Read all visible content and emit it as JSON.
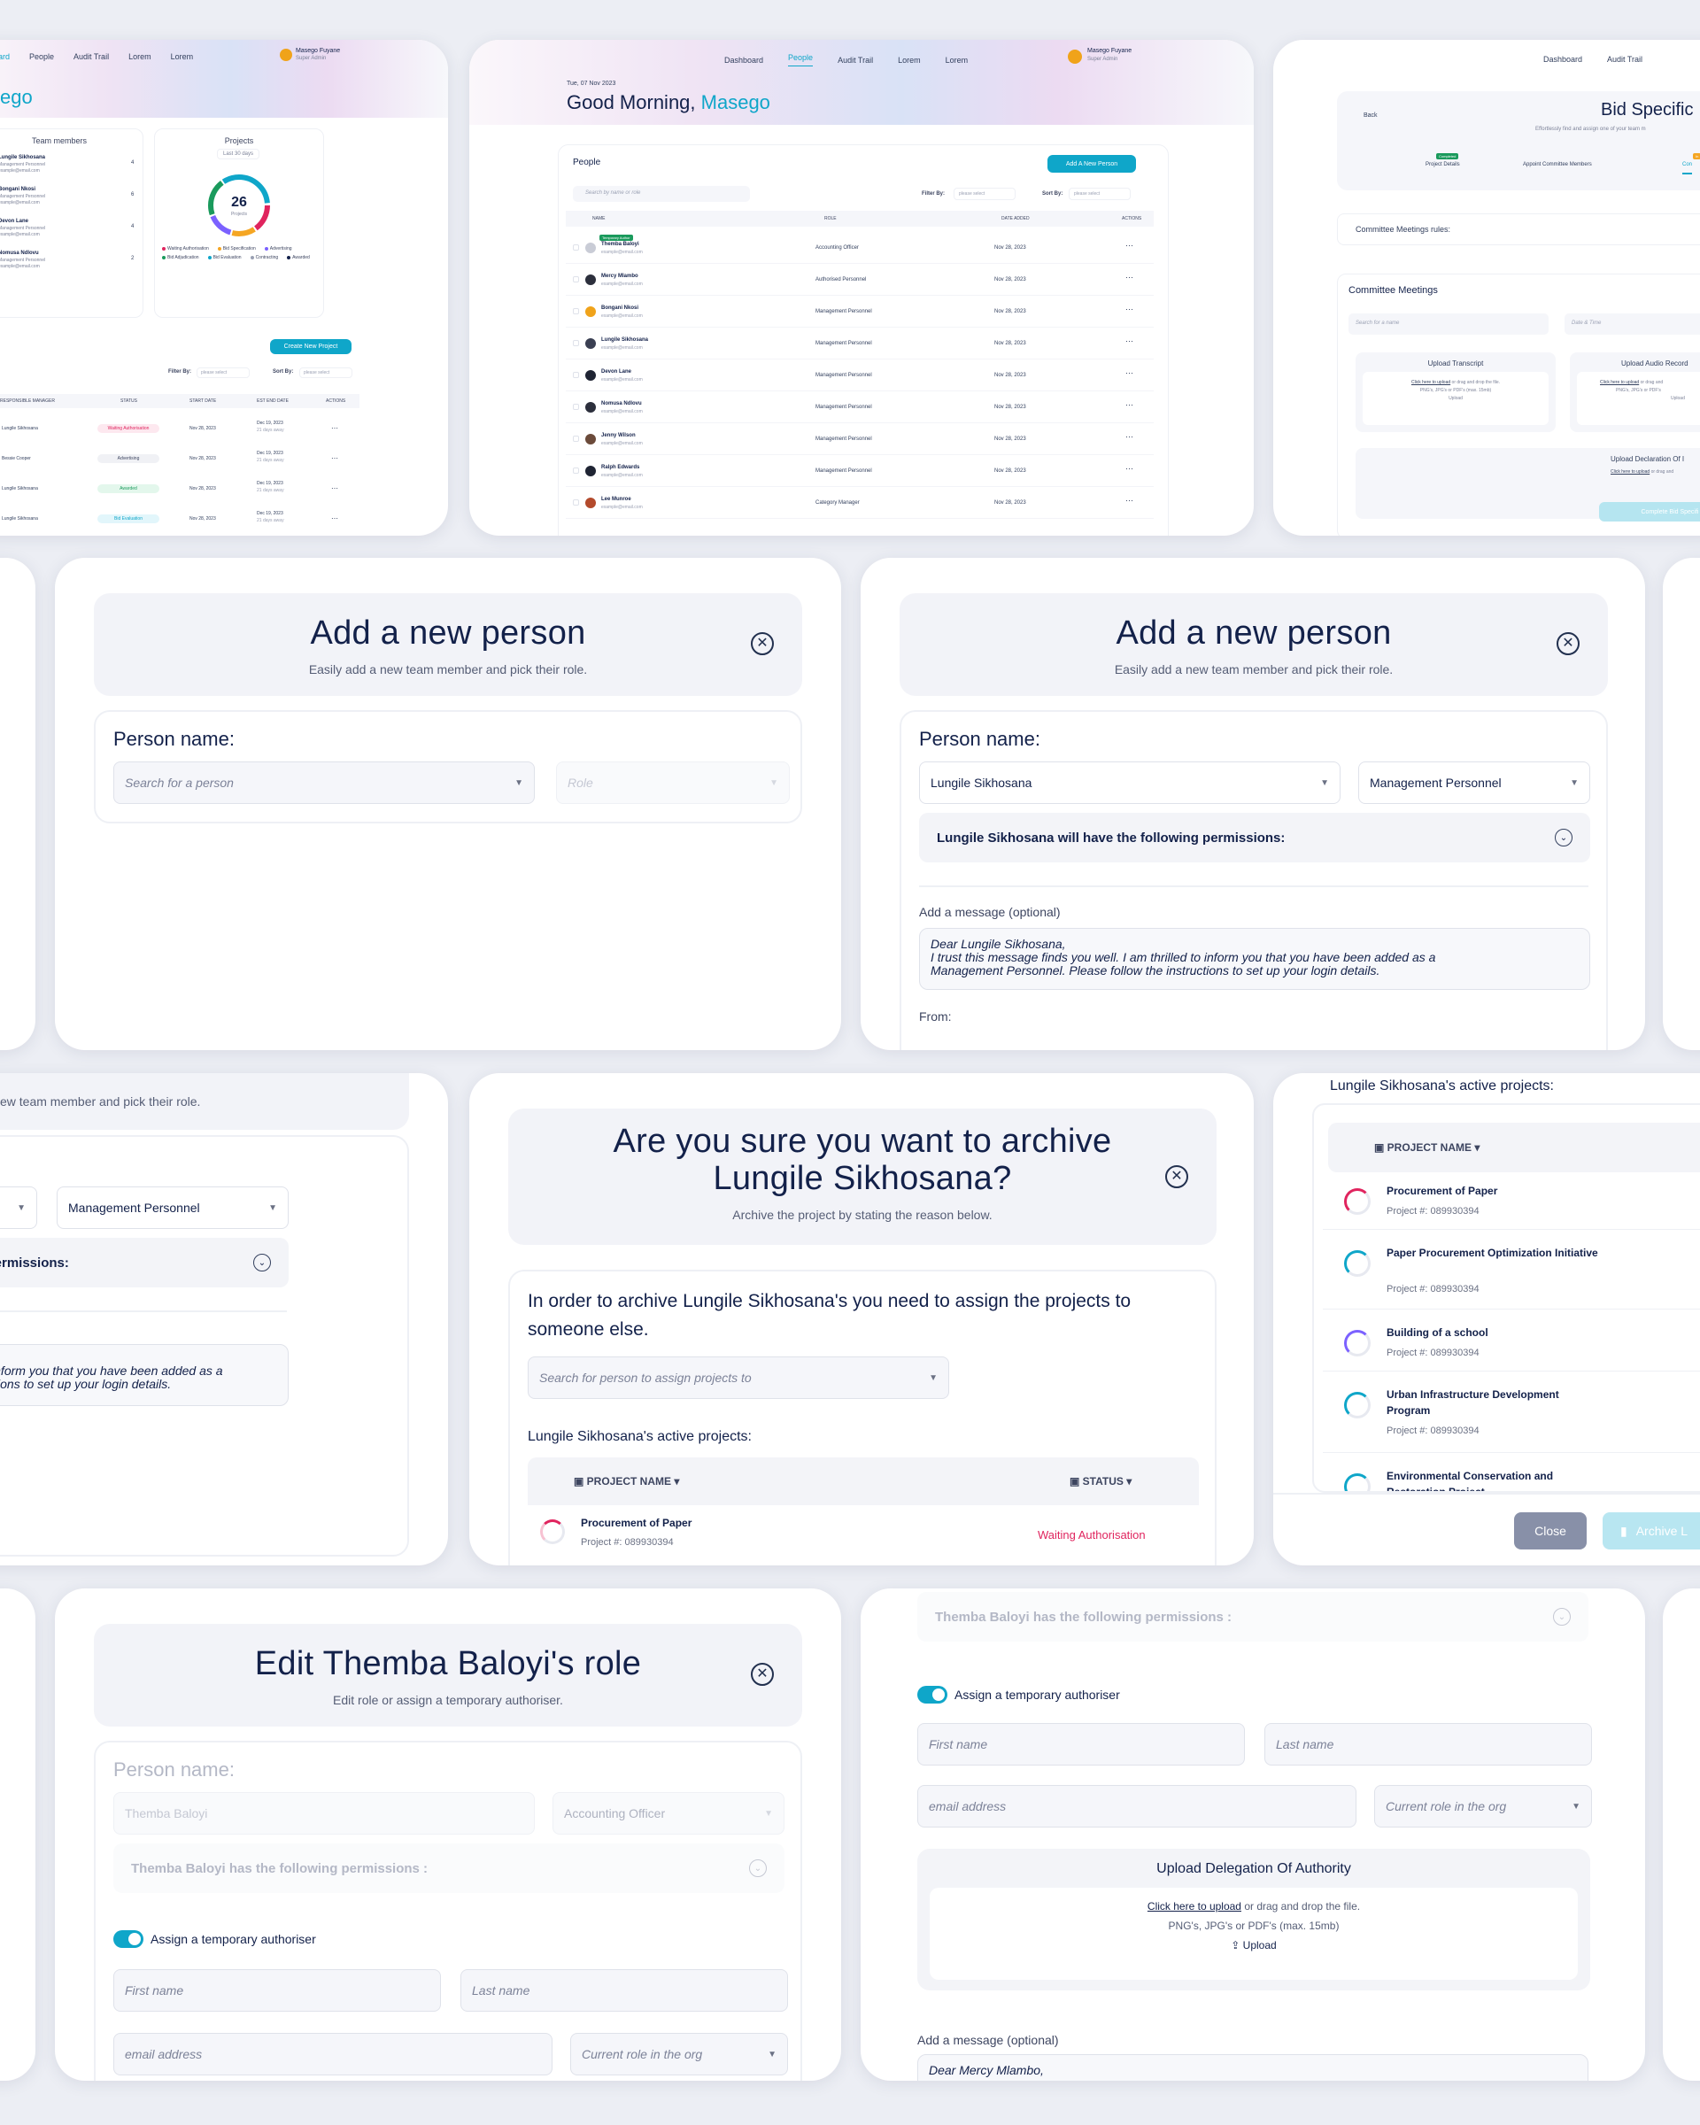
{
  "people_screen": {
    "date": "Tue, 07 Nov 2023",
    "greeting": "Good Morning, ",
    "greeting_name": "Masego",
    "nav": [
      "Dashboard",
      "People",
      "Audit Trail",
      "Lorem",
      "Lorem"
    ],
    "user_name": "Masego Fuyane",
    "user_role": "Super Admin",
    "section_title": "People",
    "add_button": "Add A New Person",
    "search_placeholder": "Search by name or role",
    "filter_label": "Filter By:",
    "sort_label": "Sort By:",
    "select_placeholder": "please select",
    "columns": [
      "NAME",
      "ROLE",
      "DATE ADDED",
      "ACTIONS"
    ],
    "rows": [
      {
        "name": "Themba Baloyi",
        "email": "example@email.com",
        "role": "Accounting Officer",
        "date": "Nov 28, 2023",
        "badge": "Temporary Author"
      },
      {
        "name": "Mercy Mlambo",
        "email": "example@email.com",
        "role": "Authorised Personnel",
        "date": "Nov 28, 2023"
      },
      {
        "name": "Bongani Nkosi",
        "email": "example@email.com",
        "role": "Management Personnel",
        "date": "Nov 28, 2023"
      },
      {
        "name": "Lungile Sikhosana",
        "email": "example@email.com",
        "role": "Management Personnel",
        "date": "Nov 28, 2023"
      },
      {
        "name": "Devon Lane",
        "email": "example@email.com",
        "role": "Management Personnel",
        "date": "Nov 28, 2023"
      },
      {
        "name": "Nomusa Ndlovu",
        "email": "example@email.com",
        "role": "Management Personnel",
        "date": "Nov 28, 2023"
      },
      {
        "name": "Jenny Wilson",
        "email": "example@email.com",
        "role": "Management Personnel",
        "date": "Nov 28, 2023"
      },
      {
        "name": "Ralph Edwards",
        "email": "example@email.com",
        "role": "Management Personnel",
        "date": "Nov 28, 2023"
      },
      {
        "name": "Lee Munroe",
        "email": "example@email.com",
        "role": "Category Manager",
        "date": "Nov 28, 2023"
      }
    ]
  },
  "dashboard_screen": {
    "nav": [
      "People",
      "Audit Trail",
      "Lorem",
      "Lorem"
    ],
    "nav_first": "ard",
    "user_name": "Masego Fuyane",
    "user_role": "Super Admin",
    "greeting_fragment": "ego",
    "team_title": "Team members",
    "team": [
      {
        "name": "Lungile Sikhosana",
        "role": "Management Personnel",
        "email": "example@email.com",
        "count": "4"
      },
      {
        "name": "Bongani Nkosi",
        "role": "Management Personnel",
        "email": "example@email.com",
        "count": "6"
      },
      {
        "name": "Devon Lane",
        "role": "Management Personnel",
        "email": "example@email.com",
        "count": "4"
      },
      {
        "name": "Nomusa Ndlovu",
        "role": "Management Personnel",
        "email": "example@email.com",
        "count": "2"
      }
    ],
    "projects_title": "Projects",
    "projects_range": "Last 30 days",
    "projects_total": "26",
    "projects_total_label": "Projects",
    "legend": [
      "Waiting Authorisation",
      "Bid Specification",
      "Advertising",
      "Bid Adjudication",
      "Bid Evaluation",
      "Contracting",
      "Awarded"
    ],
    "create_button": "Create New Project",
    "filter_label": "Filter By:",
    "sort_label": "Sort By:",
    "select_placeholder": "please select",
    "columns": [
      "RESPONSIBLE MANAGER",
      "STATUS",
      "START DATE",
      "EST END DATE",
      "ACTIONS"
    ],
    "rows": [
      {
        "manager": "Lungile Sikhosana",
        "status": "Waiting Authorisation",
        "start": "Nov 28, 2023",
        "end": "Dec 19, 2023",
        "left": "21 days away",
        "color": "#e0245e",
        "bg": "#fde8ef"
      },
      {
        "manager": "Bessie Cooper",
        "status": "Advertising",
        "start": "Nov 28, 2023",
        "end": "Dec 19, 2023",
        "left": "21 days away",
        "color": "#3d4560",
        "bg": "#f0f1f5"
      },
      {
        "manager": "Lungile Sikhosana",
        "status": "Awarded",
        "start": "Nov 28, 2023",
        "end": "Dec 19, 2023",
        "left": "21 days away",
        "color": "#1a9a5c",
        "bg": "#e3f7ec"
      },
      {
        "manager": "Lungile Sikhosana",
        "status": "Bid Evaluation",
        "start": "Nov 28, 2023",
        "end": "Dec 19, 2023",
        "left": "21 days away",
        "color": "#0fa6c9",
        "bg": "#e2f6fb"
      }
    ]
  },
  "bid_screen": {
    "nav": [
      "Dashboard",
      "Audit Trail"
    ],
    "back": "Back",
    "title": "Bid Specific",
    "subtitle": "Effortlessly find and assign one of your team m",
    "steps": [
      {
        "badge": "Completed",
        "label": "Project Details"
      },
      {
        "label": "Appoint Committee Members"
      },
      {
        "badge": "In",
        "label": "Con"
      }
    ],
    "rules_label": "Committee Meetings rules:",
    "meetings_title": "Committee Meetings",
    "search_placeholder": "Search for a name",
    "date_placeholder": "Date & Time",
    "upload_transcript": "Upload Transcript",
    "upload_audio": "Upload Audio Record",
    "upload_declaration": "Upload Declaration Of I",
    "upload_link": "Click here to upload",
    "upload_rest": "or drag and drop the file.",
    "upload_rest_short": "or drag and",
    "upload_types": "PNG's, JPG's or PDF's (max. 15mb)",
    "upload_types_short": "PNG's, JPG's or PDF's",
    "upload_btn": "Upload",
    "complete_btn": "Complete Bid Specifi"
  },
  "add_person_empty": {
    "title": "Add a new person",
    "subtitle": "Easily add a new team member and pick their role.",
    "person_label": "Person name:",
    "search_placeholder": "Search for a person",
    "role_placeholder": "Role"
  },
  "add_person_filled": {
    "title": "Add a new person",
    "subtitle": "Easily add a new team member and pick their role.",
    "person_label": "Person name:",
    "person_value": "Lungile Sikhosana",
    "role_value": "Management Personnel",
    "permissions": "Lungile Sikhosana will have the following permissions:",
    "message_label": "Add a message (optional)",
    "message_line1": "Dear Lungile Sikhosana,",
    "message_line2": "I trust this message finds you well. I am thrilled to inform you that you have been added as a",
    "message_line3": "Management Personnel. Please follow the instructions to set up your login details.",
    "from_label": "From:"
  },
  "add_person_partial": {
    "subtitle": "ew team member and pick their role.",
    "role_value": "Management Personnel",
    "permissions": "ng permissions:",
    "message_line1": "ed to inform you that you have been added as a",
    "message_line2": "nstructions to set up your login details."
  },
  "archive_modal": {
    "title_line1": "Are you sure you want to archive",
    "title_line2": "Lungile Sikhosana?",
    "subtitle": "Archive the project by stating the reason below.",
    "instruction": "In order to archive Lungile Sikhosana's you need to assign the projects to someone else.",
    "search_placeholder": "Search for person to assign projects to",
    "active_projects_label": "Lungile Sikhosana's active projects:",
    "col_project": "PROJECT NAME",
    "col_status": "STATUS",
    "project_name": "Procurement of Paper",
    "project_number": "Project #: 089930394",
    "project_status": "Waiting Authorisation"
  },
  "active_projects": {
    "label": "Lungile Sikhosana's active projects:",
    "col_project": "PROJECT NAME",
    "projects": [
      {
        "name": "Procurement of Paper",
        "number": "Project #: 089930394"
      },
      {
        "name": "Paper Procurement Optimization Initiative",
        "number": "Project #: 089930394"
      },
      {
        "name": "Building of a school",
        "number": "Project #: 089930394"
      },
      {
        "name": "Urban Infrastructure Development Program",
        "number": "Project #: 089930394"
      },
      {
        "name": "Environmental Conservation and Restoration Project",
        "number": ""
      }
    ],
    "close_btn": "Close",
    "archive_btn": "Archive L"
  },
  "edit_role": {
    "title": "Edit Themba Baloyi's role",
    "subtitle": "Edit role or assign a temporary authoriser.",
    "person_label": "Person name:",
    "person_value": "Themba Baloyi",
    "role_value": "Accounting Officer",
    "permissions": "Themba Baloyi has the following permissions :",
    "toggle_label": "Assign a temporary authoriser",
    "first_name": "First name",
    "last_name": "Last name",
    "email": "email address",
    "current_role": "Current role in the org"
  },
  "temp_authoriser": {
    "permissions": "Themba Baloyi has the following permissions :",
    "toggle_label": "Assign a temporary authoriser",
    "first_name": "First name",
    "last_name": "Last name",
    "email": "email address",
    "current_role": "Current role in the org",
    "upload_title": "Upload Delegation Of Authority",
    "upload_link": "Click here to upload",
    "upload_rest": " or drag and drop the file.",
    "upload_types": "PNG's, JPG's or PDF's (max. 15mb)",
    "upload_btn": "Upload",
    "message_label": "Add a message (optional)",
    "message_line1": "Dear Mercy Mlambo,"
  }
}
